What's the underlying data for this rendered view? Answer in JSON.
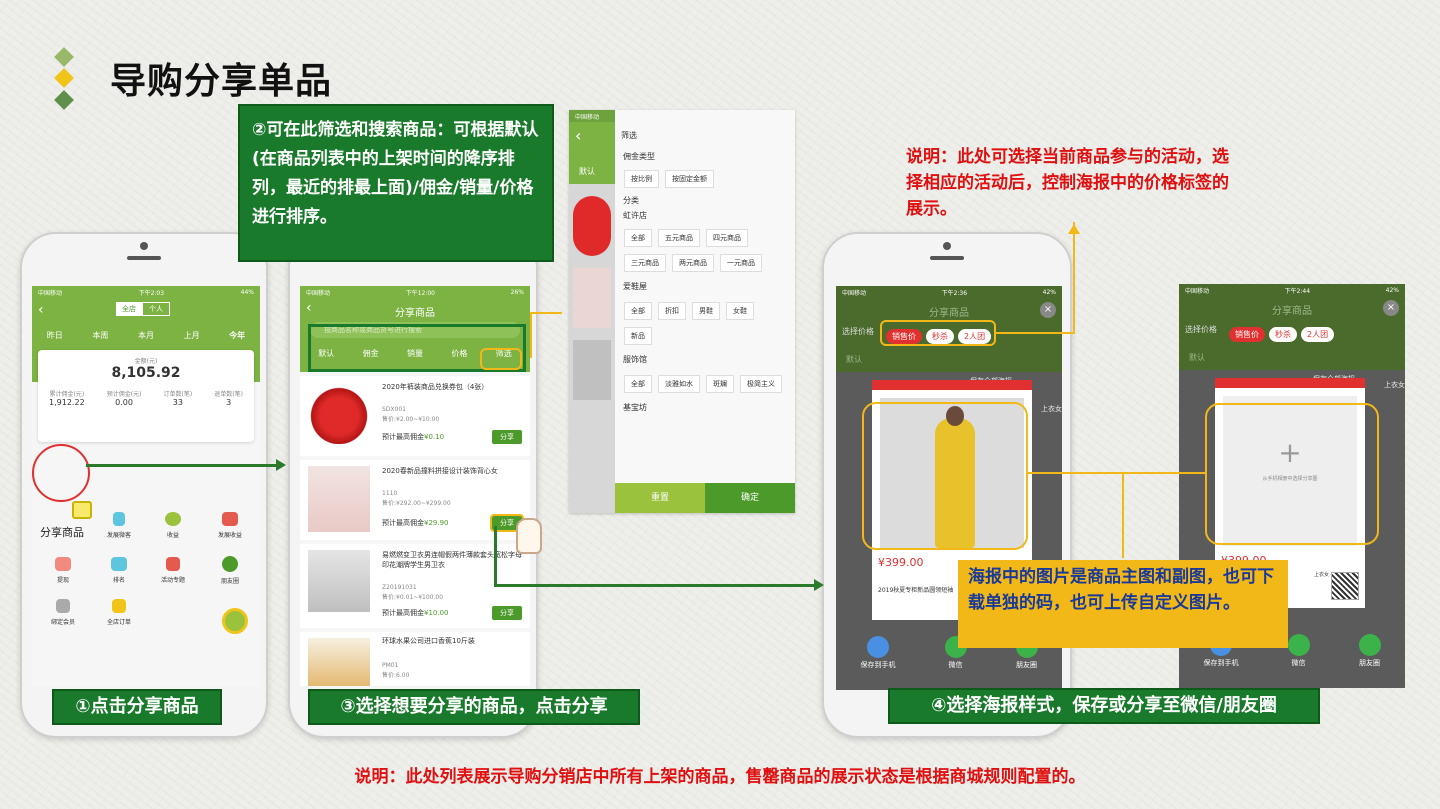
{
  "page": {
    "title": "导购分享单品",
    "bottom_note": "说明：此处列表展示导购分销店中所有上架的商品，售罄商品的展示状态是根据商城规则配置的。"
  },
  "callouts": {
    "c1": "①点击分享商品",
    "c2": "②可在此筛选和搜索商品：可根据默认(在商品列表中的上架时间的降序排列，最近的排最上面)/佣金/销量/价格进行排序。",
    "c3": "③选择想要分享的商品，点击分享",
    "c4": "④选择海报样式，保存或分享至微信/朋友圈",
    "red_note": "说明：此处可选择当前商品参与的活动，选择相应的活动后，控制海报中的价格标签的展示。",
    "poster_note": "海报中的图片是商品主图和副图，也可下载单独的码，也可上传自定义图片。"
  },
  "phone1": {
    "status_left": "中国移动",
    "status_time": "下午2:03",
    "status_right": "44%",
    "toggle": [
      "全店",
      "个人"
    ],
    "tabs": [
      "昨日",
      "本周",
      "本月",
      "上月",
      "今年"
    ],
    "amount_label": "金额(元)",
    "amount": "8,105.92",
    "stats": [
      {
        "label": "累计佣金(元)",
        "value": "1,912.22"
      },
      {
        "label": "预计佣金(元)",
        "value": "0.00"
      },
      {
        "label": "订单数(笔)",
        "value": "33"
      },
      {
        "label": "退单数(笔)",
        "value": "3"
      }
    ],
    "menu": [
      "分享商品",
      "发展微客",
      "收益",
      "发展收益",
      "提现",
      "排名",
      "活动专题",
      "朋友圈",
      "绑定会员",
      "全店订单"
    ]
  },
  "phone2": {
    "status_left": "中国移动",
    "status_time": "下午12:00",
    "status_right": "26%",
    "header": "分享商品",
    "search_placeholder": "按商品名称或商品货号进行搜索",
    "sort": [
      "默认",
      "佣金",
      "销量",
      "价格",
      "筛选"
    ],
    "items": [
      {
        "name": "2020年裤装商品兑换券包（4张）",
        "sku": "SDX001",
        "price": "售价:¥2.00~¥10.00",
        "commission": "预计最高佣金",
        "commission_val": "¥0.10",
        "btn": "分享"
      },
      {
        "name": "2020春新品撞料拼接设计装饰背心女",
        "sku": "1110",
        "price": "售价:¥292.00~¥299.00",
        "commission": "预计最高佣金",
        "commission_val": "¥29.90",
        "btn": "分享"
      },
      {
        "name": "易燃燃变卫衣男连帽假两件薄款套头宽松字母印花潮牌学生男卫衣",
        "sku": "Z20191031",
        "price": "售价:¥0.01~¥100.00",
        "commission": "预计最高佣金",
        "commission_val": "¥10.00",
        "btn": "分享"
      },
      {
        "name": "环球水果公司进口香蕉10斤装",
        "sku": "PM01",
        "price": "售价:6.00",
        "commission": "",
        "commission_val": "",
        "btn": ""
      }
    ]
  },
  "filter": {
    "status_left": "中国移动",
    "title": "筛选",
    "sec1": "佣金类型",
    "opts1": [
      "按比例",
      "按固定金额"
    ],
    "sec2": "分类",
    "store1": "虹许店",
    "opts2": [
      "全部",
      "五元商品",
      "四元商品",
      "三元商品",
      "两元商品",
      "一元商品"
    ],
    "store2": "爱鞋屋",
    "opts3": [
      "全部",
      "折扣",
      "男鞋",
      "女鞋",
      "新品"
    ],
    "store3": "服饰馆",
    "opts4": [
      "全部",
      "淡雅如水",
      "斑斓",
      "极简主义"
    ],
    "store4": "基宝坊",
    "btn_reset": "重置",
    "btn_ok": "确定",
    "side_tab": "默认"
  },
  "phone3": {
    "status_left": "中国移动",
    "status_time": "下午2:36",
    "status_right": "42%",
    "header": "分享商品",
    "select_label": "选择价格",
    "tags": [
      "销售价",
      "秒杀",
      "2人团"
    ],
    "save_all": "保存全部海报",
    "price": "¥399.00",
    "caption": "2019秋夏专柜新品圆领短袖",
    "share": [
      "保存到手机",
      "微信",
      "朋友圈"
    ],
    "bg_tab": "默认",
    "side_text": "上衣女"
  },
  "phone4": {
    "status_left": "中国移动",
    "status_time": "下午2:44",
    "status_right": "42%",
    "header": "分享商品",
    "select_label": "选择价格",
    "tags": [
      "销售价",
      "秒杀",
      "2人团"
    ],
    "save_all": "保存全部海报",
    "price": "¥399.00",
    "upload": "从手机相册中选择分享图",
    "caption": "上衣女",
    "side_text": "上衣女",
    "share": [
      "保存到手机",
      "微信",
      "朋友圈"
    ],
    "bg_tab": "默认"
  }
}
